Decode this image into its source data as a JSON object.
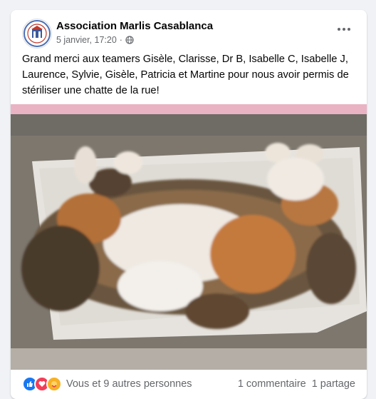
{
  "post": {
    "page_name": "Association Marlis Casablanca",
    "timestamp": "5 janvier, 17:20",
    "separator": "·",
    "text": "Grand merci aux teamers Gisèle, Clarisse, Dr B, Isabelle C, Isabelle J, Laurence, Sylvie, Gisèle, Patricia et Martine pour nous avoir permis de stériliser une chatte de la rue!"
  },
  "footer": {
    "reactions_text": "Vous et 9 autres personnes",
    "comments_text": "1 commentaire",
    "shares_text": "1 partage"
  },
  "icons": {
    "audience": "globe-icon",
    "more": "more-options-icon",
    "reactions": [
      "like-icon",
      "love-icon",
      "care-icon"
    ]
  },
  "colors": {
    "like": "#1877f2",
    "love": "#f33e58",
    "care": "#f7b125",
    "secondary_text": "#65676b"
  }
}
